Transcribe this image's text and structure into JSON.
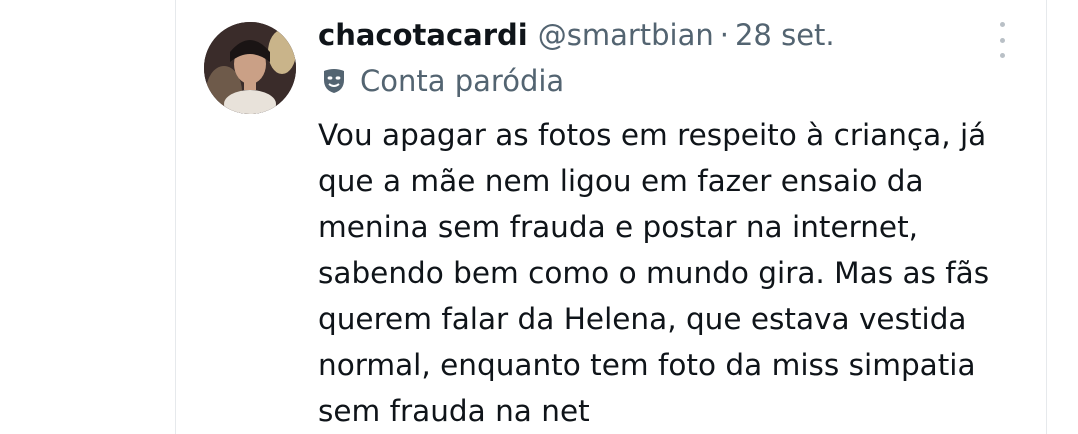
{
  "tweet": {
    "display_name": "chacotacardi",
    "handle": "@smartbian",
    "separator": "·",
    "date": "28 set.",
    "label": "Conta paródia",
    "label_icon": "parody-mask-icon",
    "more_icon": "more-vertical-icon",
    "text_lines": [
      "Vou apagar as fotos em respeito à criança, já",
      "que a mãe nem ligou em fazer ensaio da",
      "menina sem frauda e postar na internet,",
      "sabendo bem como o mundo gira. Mas as fãs",
      "querem falar da Helena, que estava vestida",
      "normal, enquanto tem foto da miss simpatia",
      "sem frauda na net"
    ]
  },
  "colors": {
    "text_primary": "#0f1419",
    "text_secondary": "#536471",
    "border": "#e6e9ec"
  }
}
